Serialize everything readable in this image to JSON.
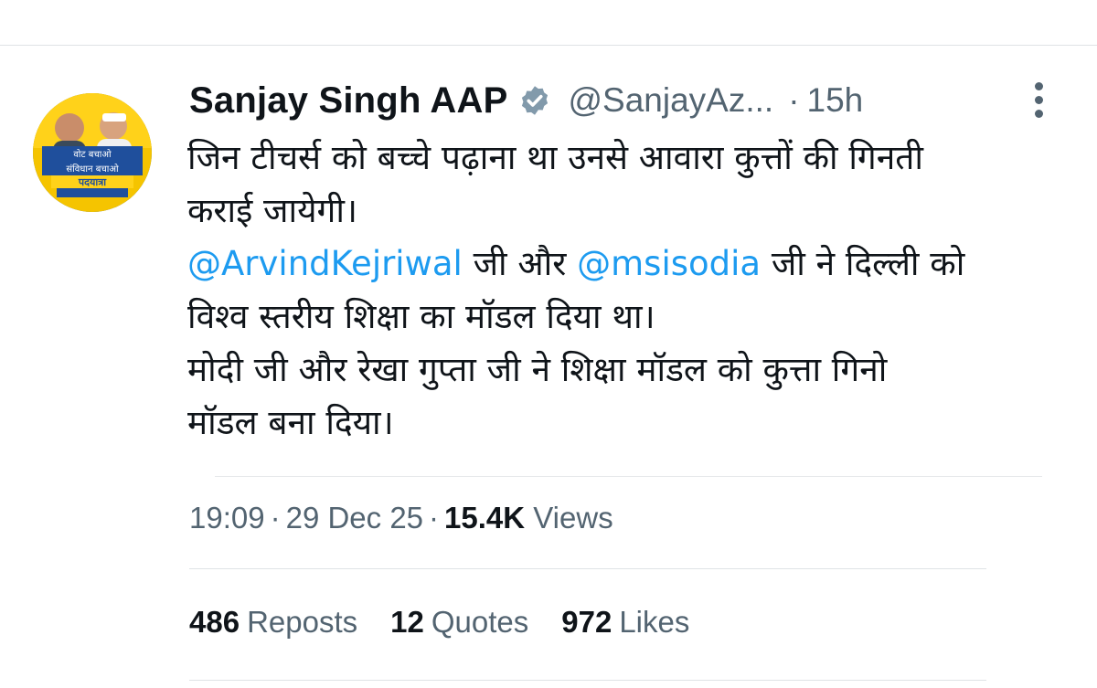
{
  "tweet": {
    "display_name": "Sanjay Singh AAP",
    "handle": "@SanjayAz...",
    "dot": "·",
    "relative_time": "15h",
    "text": {
      "line1": "जिन टीचर्स को बच्चे पढ़ाना था उनसे आवारा कुत्तों की गिनती",
      "line2": "कराई जायेगी।",
      "mention1": "@ArvindKejriwal",
      "mid1": " जी और ",
      "mention2": "@msisodia",
      "tail1": " जी ने दिल्ली को",
      "line4": "विश्व स्तरीय शिक्षा का मॉडल दिया था।",
      "line5": "मोदी जी और रेखा गुप्ता जी ने शिक्षा मॉडल को कुत्ता गिनो",
      "line6": "मॉडल बना दिया।"
    },
    "avatar_banner": {
      "line1": "वोट बचाओ",
      "line2": "संविधान बचाओ",
      "line3": "पदयात्रा"
    },
    "meta": {
      "time": "19:09",
      "sep": "·",
      "date": "29 Dec 25",
      "views_count": "15.4K",
      "views_label": "Views"
    },
    "stats": {
      "reposts_count": "486",
      "reposts_label": "Reposts",
      "quotes_count": "12",
      "quotes_label": "Quotes",
      "likes_count": "972",
      "likes_label": "Likes"
    }
  },
  "icons": {
    "verified": "verified-badge-icon",
    "more": "more-vertical-icon"
  },
  "colors": {
    "link": "#1d9bf0",
    "muted": "#536471",
    "text": "#0f1419",
    "avatar_yellow": "#f5c400",
    "avatar_blue": "#2b6fc2"
  }
}
